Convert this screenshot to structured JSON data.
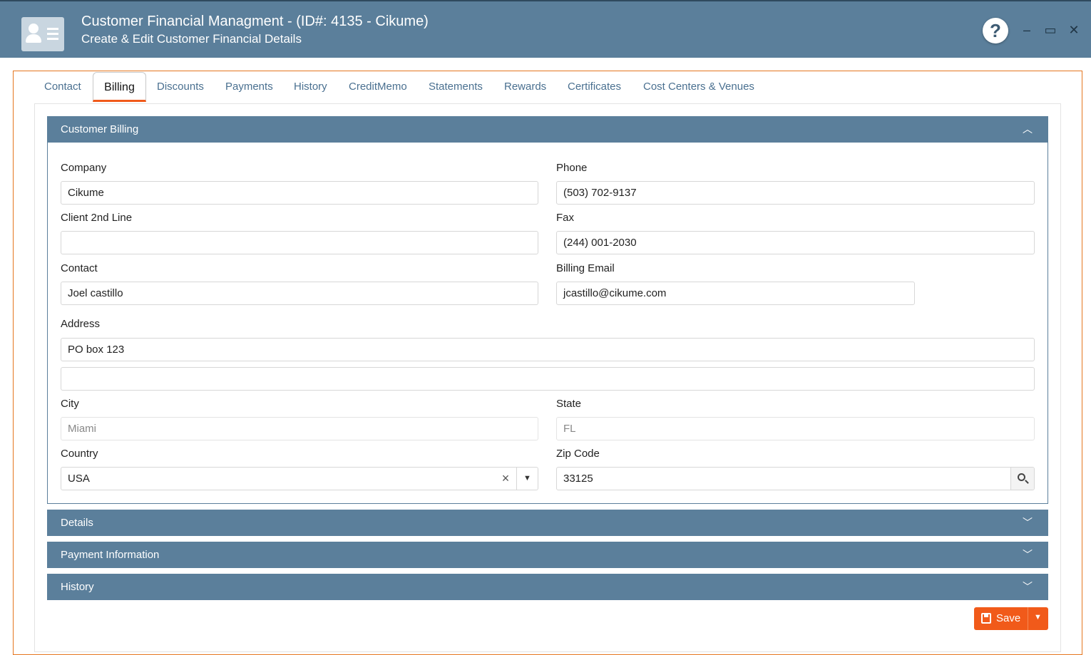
{
  "window": {
    "title": "Customer Financial Managment - (ID#: 4135 - Cikume)",
    "subtitle": "Create & Edit Customer Financial Details",
    "help_glyph": "?",
    "minimize_glyph": "–",
    "maximize_glyph": "▭",
    "close_glyph": "✕"
  },
  "tabs": [
    "Contact",
    "Billing",
    "Discounts",
    "Payments",
    "History",
    "CreditMemo",
    "Statements",
    "Rewards",
    "Certificates",
    "Cost Centers & Venues"
  ],
  "active_tab": "Billing",
  "sections": {
    "customer_billing": "Customer Billing",
    "details": "Details",
    "payment_information": "Payment Information",
    "history": "History"
  },
  "form": {
    "company": {
      "label": "Company",
      "value": "Cikume"
    },
    "phone": {
      "label": "Phone",
      "value": "(503) 702-9137"
    },
    "client_2nd_line": {
      "label": "Client 2nd Line",
      "value": ""
    },
    "fax": {
      "label": "Fax",
      "value": "(244) 001-2030"
    },
    "contact": {
      "label": "Contact",
      "value": "Joel castillo"
    },
    "billing_email": {
      "label": "Billing Email",
      "value": "jcastillo@cikume.com"
    },
    "address": {
      "label": "Address",
      "line1": "PO box 123",
      "line2": ""
    },
    "city": {
      "label": "City",
      "value": "Miami"
    },
    "state": {
      "label": "State",
      "value": "FL"
    },
    "country": {
      "label": "Country",
      "value": "USA"
    },
    "zip": {
      "label": "Zip Code",
      "value": "33125"
    }
  },
  "icons": {
    "collapse": "chevron-up-icon",
    "expand": "chevron-down-icon",
    "clear": "×",
    "dropdown": "▼",
    "search": "search-icon",
    "save": "floppy-disk-icon"
  },
  "actions": {
    "save_label": "Save",
    "save_menu_glyph": "▼"
  },
  "colors": {
    "header": "#5b7f9b",
    "accent": "#f15a1a",
    "tab_text": "#4a7090"
  }
}
